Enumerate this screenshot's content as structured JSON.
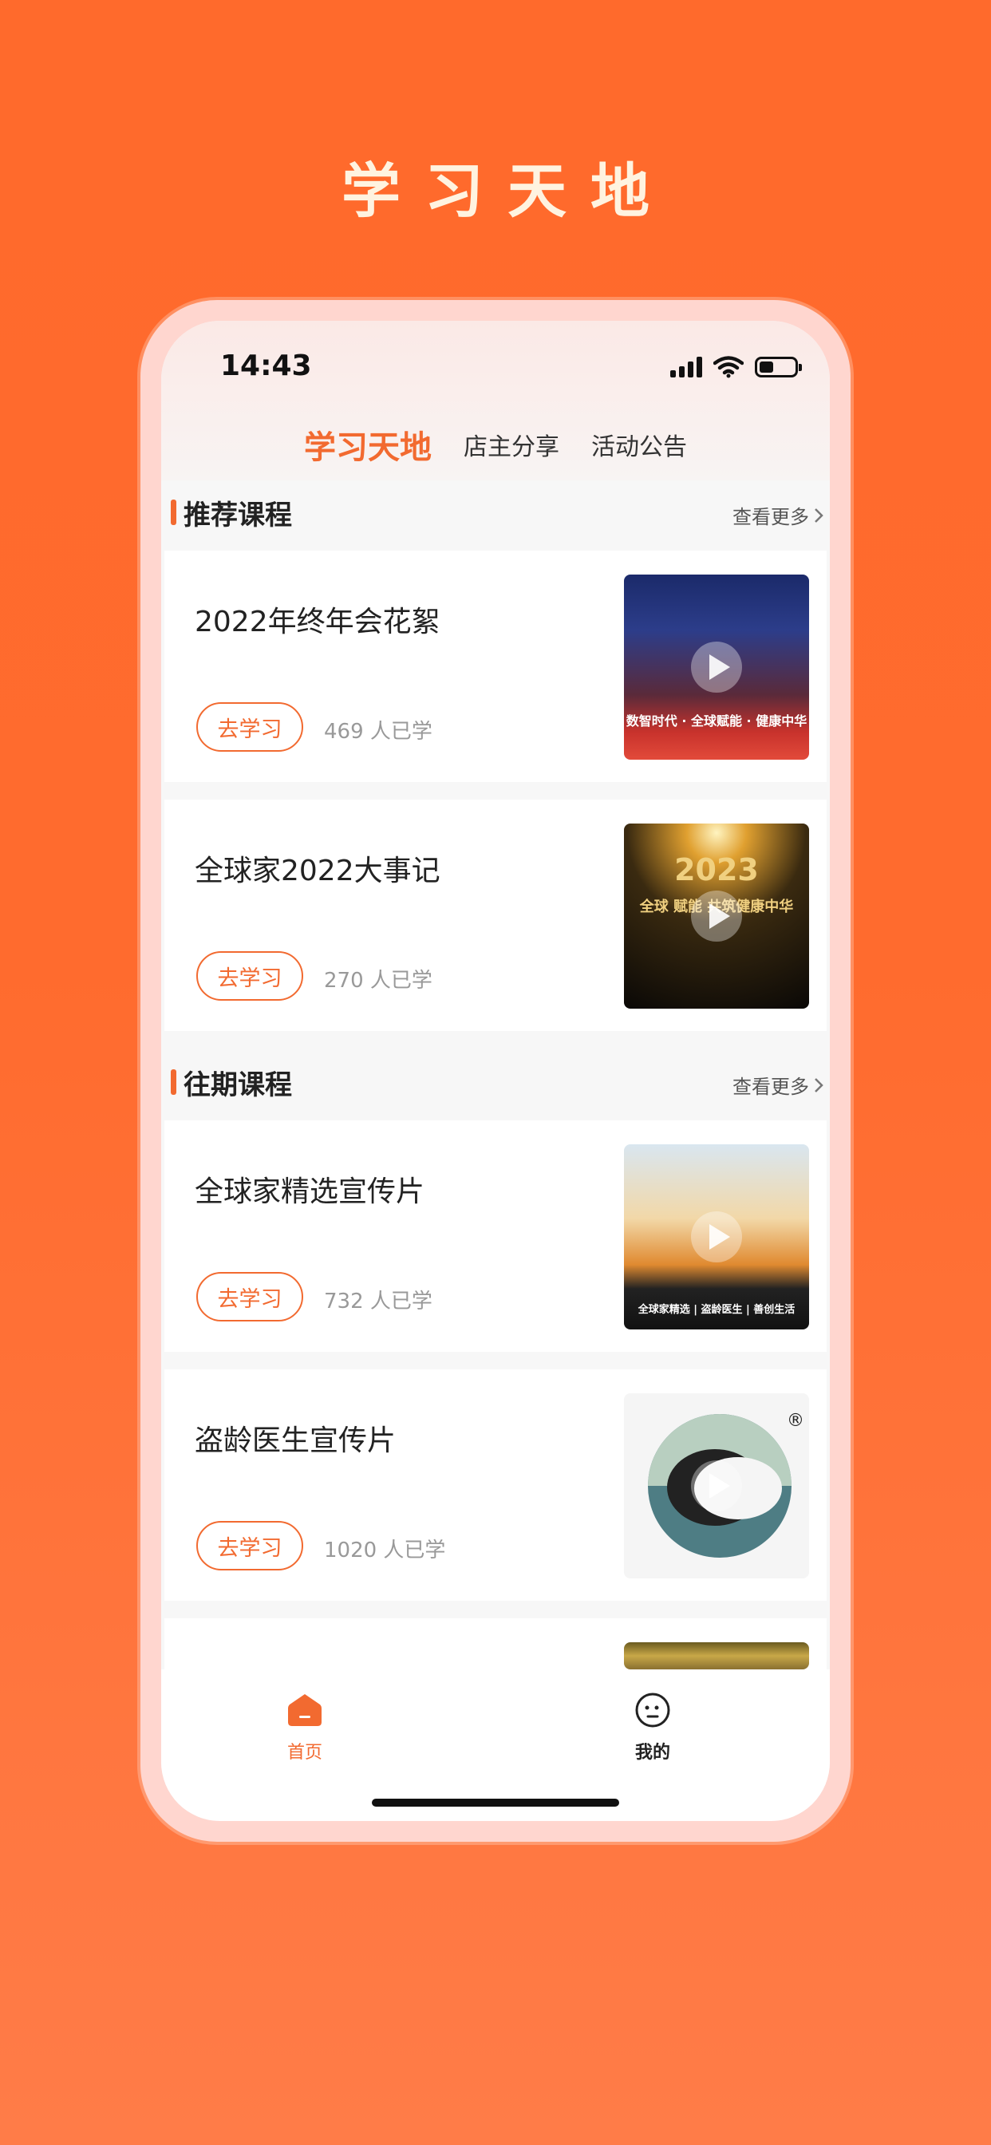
{
  "promo": {
    "title": "学习天地"
  },
  "status_bar": {
    "time": "14:43"
  },
  "tabs": [
    {
      "label": "学习天地",
      "active": true
    },
    {
      "label": "店主分享",
      "active": false
    },
    {
      "label": "活动公告",
      "active": false
    }
  ],
  "sections": {
    "recommended": {
      "title": "推荐课程",
      "more": "查看更多"
    },
    "past": {
      "title": "往期课程",
      "more": "查看更多"
    }
  },
  "courses": [
    {
      "title": "2022年终年会花絮",
      "button": "去学习",
      "count": "469 人已学",
      "thumb_text": "数智时代 · 全球赋能 · 健康中华"
    },
    {
      "title": "全球家2022大事记",
      "button": "去学习",
      "count": "270 人已学",
      "thumb_text": "2023",
      "thumb_sub": "全球 赋能 共筑健康中华"
    },
    {
      "title": "全球家精选宣传片",
      "button": "去学习",
      "count": "732 人已学",
      "thumb_text": "全球家精选 | 盗龄医生 | 善创生活"
    },
    {
      "title": "盗龄医生宣传片",
      "button": "去学习",
      "count": "1020 人已学",
      "thumb_text": "®"
    }
  ],
  "bottom_nav": {
    "home": {
      "label": "首页",
      "icon": "home-icon"
    },
    "me": {
      "label": "我的",
      "icon": "face-icon"
    }
  },
  "colors": {
    "accent": "#f26a30",
    "background": "#ff6a2c"
  }
}
